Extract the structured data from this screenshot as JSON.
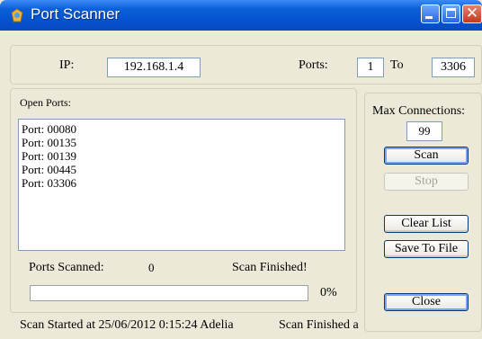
{
  "window": {
    "title": "Port Scanner"
  },
  "scan_params": {
    "ip_label": "IP:",
    "ip_value": "192.168.1.4",
    "ports_label": "Ports:",
    "port_from": "1",
    "to_label": "To",
    "port_to": "3306"
  },
  "open_ports": {
    "label": "Open Ports:",
    "items": [
      "Port: 00080",
      "Port: 00135",
      "Port: 00139",
      "Port: 00445",
      "Port: 03306"
    ]
  },
  "progress": {
    "scanned_label": "Ports Scanned:",
    "scanned_count": "0",
    "status_text": "Scan Finished!",
    "percent_text": "0%",
    "percent_value": 0,
    "fill_color": "#3c8a3c"
  },
  "controls": {
    "max_conn_label": "Max Connections:",
    "max_conn_value": "99",
    "scan_label": "Scan",
    "stop_label": "Stop",
    "clear_label": "Clear List",
    "save_label": "Save To File",
    "close_label": "Close"
  },
  "statusbar": {
    "started": "Scan Started at 25/06/2012 0:15:24 Adelia",
    "finished": "Scan Finished a"
  },
  "icons": {
    "app": "app-icon",
    "minimize": "minimize-icon",
    "maximize": "maximize-icon",
    "close": "close-icon"
  },
  "colors": {
    "titlebar": "#0553d0",
    "close_button": "#c4391c",
    "window_bg": "#ece9d8"
  }
}
